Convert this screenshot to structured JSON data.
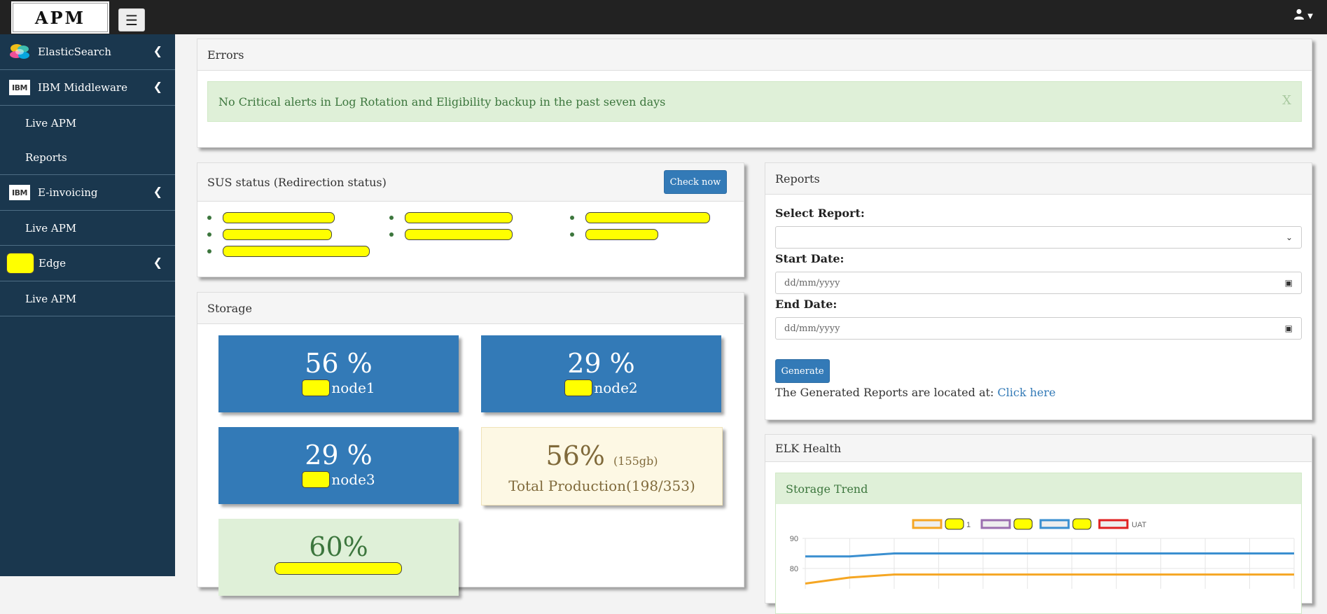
{
  "app": {
    "logo_text": "APM",
    "menu_icon": "hamburger-icon",
    "user_icon": "user-icon"
  },
  "sidebar": {
    "groups": [
      {
        "label": "ElasticSearch",
        "icon": "elasticsearch-icon",
        "items": []
      },
      {
        "label": "IBM Middleware",
        "icon": "ibm-logo-icon",
        "icon_text": "IBM",
        "items": [
          "Live APM",
          "Reports"
        ]
      },
      {
        "label": "E-invoicing",
        "icon": "ibm-logo-icon",
        "icon_text": "IBM",
        "items": [
          "Live APM"
        ]
      },
      {
        "label": "Edge",
        "icon": "redacted-logo-icon",
        "items": [
          "Live APM"
        ]
      }
    ]
  },
  "errors_panel": {
    "title": "Errors",
    "alert_text": "No Critical alerts in Log Rotation and Eligibility backup in the past seven days",
    "close_label": "X"
  },
  "sus_panel": {
    "title": "SUS status (Redirection status)",
    "check_button": "Check now",
    "item_count": 7
  },
  "storage_panel": {
    "title": "Storage",
    "tiles": [
      {
        "percent": "56 %",
        "label": "node1",
        "style": "blue",
        "value": 56
      },
      {
        "percent": "29 %",
        "label": "node2",
        "style": "blue",
        "value": 29
      },
      {
        "percent": "29 %",
        "label": "node3",
        "style": "blue",
        "value": 29
      },
      {
        "percent": "56%",
        "size": "(155gb)",
        "label": "Total Production(198/353)",
        "style": "cream",
        "value": 56
      },
      {
        "percent": "60%",
        "style": "green",
        "value": 60
      }
    ]
  },
  "reports_panel": {
    "title": "Reports",
    "select_label": "Select Report:",
    "select_value": "",
    "start_label": "Start Date:",
    "start_placeholder": "dd/mm/yyyy",
    "end_label": "End Date:",
    "end_placeholder": "dd/mm/yyyy",
    "generate_button": "Generate",
    "note_text": "The Generated Reports are located at: ",
    "note_link": "Click here"
  },
  "elk_panel": {
    "title": "ELK Health",
    "trend_title": "Storage Trend"
  },
  "chart_data": {
    "type": "line",
    "title": "",
    "legend_placement": "top",
    "y_ticks": [
      90,
      80
    ],
    "grid": true,
    "series": [
      {
        "name": "1",
        "color": "#f5a623",
        "values": [
          75,
          77,
          78,
          78,
          78,
          78,
          78,
          78,
          78,
          78,
          78,
          78
        ]
      },
      {
        "name": "",
        "color": "#9b6fb0",
        "values": []
      },
      {
        "name": "",
        "color": "#3a8fd0",
        "values": [
          84,
          84,
          85,
          85,
          85,
          85,
          85,
          85,
          85,
          85,
          85,
          85
        ]
      },
      {
        "name": "UAT",
        "color": "#e02020",
        "values": []
      }
    ]
  }
}
